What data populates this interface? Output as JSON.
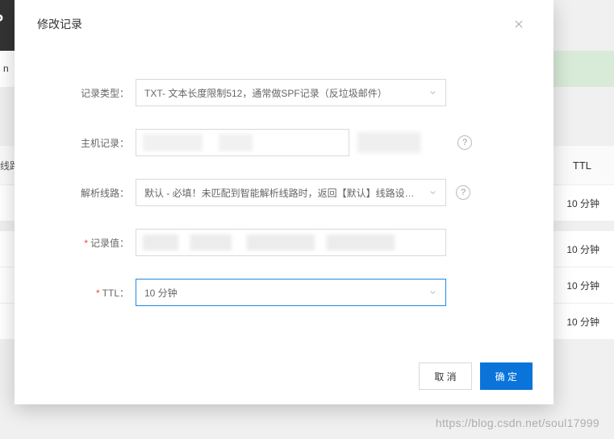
{
  "background": {
    "header_fragment": "P",
    "band_fragment": "n",
    "table_head_left": "线路",
    "table_head_right": "TTL",
    "row_ttl": "10 分钟"
  },
  "modal": {
    "title": "修改记录",
    "fields": {
      "record_type": {
        "label": "记录类型：",
        "value": "TXT- 文本长度限制512，通常做SPF记录（反垃圾邮件）"
      },
      "host_record": {
        "label": "主机记录："
      },
      "resolve_line": {
        "label": "解析线路：",
        "value": "默认 - 必填！未匹配到智能解析线路时，返回【默认】线路设…"
      },
      "record_value": {
        "label": "记录值："
      },
      "ttl": {
        "label": "TTL：",
        "value": "10 分钟"
      }
    },
    "buttons": {
      "cancel": "取 消",
      "confirm": "确 定"
    }
  },
  "watermark": "https://blog.csdn.net/soul17999"
}
